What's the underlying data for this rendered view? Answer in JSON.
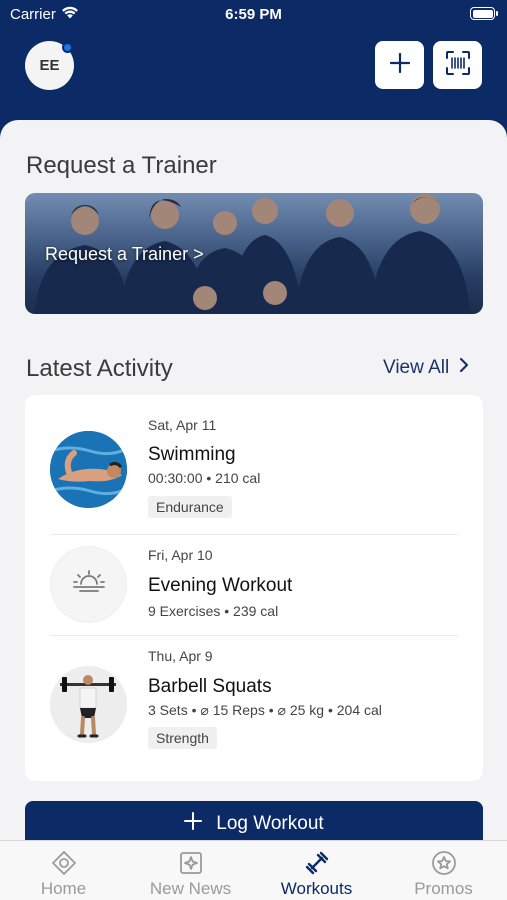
{
  "status_bar": {
    "carrier": "Carrier",
    "time": "6:59 PM"
  },
  "header": {
    "avatar_initials": "EE"
  },
  "trainer": {
    "section_title": "Request a Trainer",
    "banner_label": "Request a Trainer >"
  },
  "activity": {
    "section_title": "Latest Activity",
    "view_all": "View All",
    "items": [
      {
        "date": "Sat, Apr 11",
        "name": "Swimming",
        "meta": "00:30:00 • 210 cal",
        "tag": "Endurance"
      },
      {
        "date": "Fri, Apr 10",
        "name": "Evening Workout",
        "meta": "9 Exercises • 239 cal",
        "tag": ""
      },
      {
        "date": "Thu, Apr 9",
        "name": "Barbell Squats",
        "meta": "3 Sets • ⌀ 15 Reps • ⌀ 25 kg • 204 cal",
        "tag": "Strength"
      }
    ]
  },
  "log_workout": {
    "label": "Log Workout"
  },
  "tabs": [
    {
      "label": "Home",
      "icon": "home-diamond-icon"
    },
    {
      "label": "New News",
      "icon": "news-sparkle-icon"
    },
    {
      "label": "Workouts",
      "icon": "dumbbell-icon"
    },
    {
      "label": "Promos",
      "icon": "star-badge-icon"
    }
  ],
  "colors": {
    "brand_navy": "#0b2a66",
    "notification_dot": "#1d74e8",
    "tab_inactive": "#9a9a9a"
  }
}
